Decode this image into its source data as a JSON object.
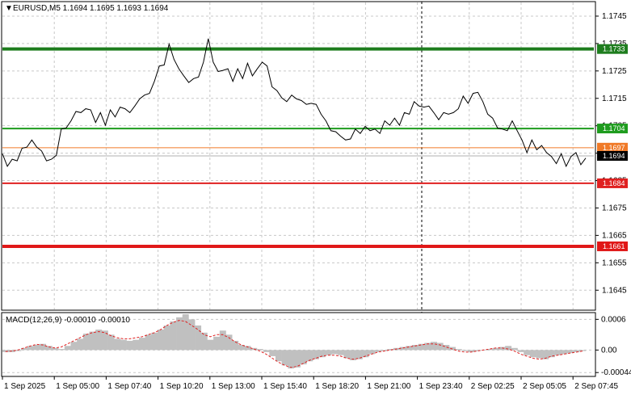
{
  "header": {
    "symbol_info": "EURUSD,M5  1.1694 1.1695 1.1693 1.1694"
  },
  "price_scale": {
    "ticks": [
      "1.1745",
      "1.1735",
      "1.1725",
      "1.1715",
      "1.1705",
      "1.1695",
      "1.1685",
      "1.1675",
      "1.1665",
      "1.1655",
      "1.1645"
    ]
  },
  "levels": [
    {
      "label": "1.1733",
      "color": "#1e7d1e"
    },
    {
      "label": "1.1704",
      "color": "#1e9c1e"
    },
    {
      "label": "1.1697",
      "color": "#f07a28"
    },
    {
      "label": "1.1694",
      "color": "#000000"
    },
    {
      "label": "1.1684",
      "color": "#e02020"
    },
    {
      "label": "1.1661",
      "color": "#e01818"
    }
  ],
  "macd": {
    "label": "MACD(12,26,9) -0.00010 -0.00010",
    "ticks": [
      "0.0006",
      "0.00",
      "-0.00044"
    ]
  },
  "time_axis": {
    "labels": [
      "1 Sep 2025",
      "1 Sep 05:00",
      "1 Sep 07:40",
      "1 Sep 10:20",
      "1 Sep 13:00",
      "1 Sep 15:40",
      "1 Sep 18:20",
      "1 Sep 21:00",
      "1 Sep 23:40",
      "2 Sep 02:25",
      "2 Sep 05:05",
      "2 Sep 07:45"
    ]
  },
  "chart_data": {
    "type": "line",
    "title": "EURUSD,M5",
    "price_range": [
      1.1638,
      1.175
    ],
    "macd_range": [
      -0.0005,
      0.0007
    ],
    "price_series": [
      1.1694,
      1.1691,
      1.1692,
      1.1693,
      1.1696,
      1.1698,
      1.1699,
      1.1698,
      1.1695,
      1.1693,
      1.1692,
      1.1695,
      1.1703,
      1.1705,
      1.1706,
      1.1711,
      1.1709,
      1.1712,
      1.171,
      1.1707,
      1.1709,
      1.1706,
      1.171,
      1.1709,
      1.1711,
      1.1712,
      1.1709,
      1.1713,
      1.1714,
      1.1717,
      1.1716,
      1.1722,
      1.1726,
      1.1728,
      1.1734,
      1.173,
      1.1725,
      1.1724,
      1.172,
      1.1723,
      1.1722,
      1.1729,
      1.1736,
      1.1729,
      1.1724,
      1.1726,
      1.1725,
      1.1722,
      1.1725,
      1.1723,
      1.1727,
      1.1724,
      1.1725,
      1.1729,
      1.1726,
      1.172,
      1.1717,
      1.1716,
      1.1713,
      1.1717,
      1.1714,
      1.1715,
      1.1712,
      1.1714,
      1.1712,
      1.171,
      1.1706,
      1.1704,
      1.1702,
      1.1702,
      1.1699,
      1.1701,
      1.1703,
      1.1703,
      1.1704,
      1.1704,
      1.1703,
      1.1703,
      1.1706,
      1.1706,
      1.1707,
      1.1706,
      1.1709,
      1.171,
      1.1713,
      1.1713,
      1.1711,
      1.1713,
      1.1709,
      1.1708,
      1.1709,
      1.171,
      1.1709,
      1.1712,
      1.1715,
      1.1714,
      1.1716,
      1.1718,
      1.1713,
      1.171,
      1.1707,
      1.1705,
      1.1703,
      1.1704,
      1.1706,
      1.1704,
      1.1699,
      1.1696,
      1.1699,
      1.1697,
      1.1697,
      1.1696,
      1.1693,
      1.1692,
      1.1694,
      1.1691,
      1.1693,
      1.1696,
      1.169,
      1.1694
    ],
    "macd_hist": [
      -4e-05,
      -4e-05,
      -2e-05,
      4e-05,
      8e-05,
      0.0001,
      0.00012,
      8e-05,
      4e-05,
      2e-05,
      8e-05,
      0.00016,
      0.00022,
      0.00032,
      0.00036,
      0.0004,
      0.00038,
      0.0003,
      0.00022,
      0.0002,
      0.00018,
      0.0002,
      0.00024,
      0.0003,
      0.00034,
      0.0004,
      0.00048,
      0.00056,
      0.00064,
      0.0007,
      0.0006,
      0.00048,
      0.00034,
      0.0002,
      0.00026,
      0.00038,
      0.0003,
      0.00018,
      0.0001,
      8e-05,
      4e-05,
      2e-05,
      -4e-05,
      -0.00012,
      -0.00022,
      -0.0003,
      -0.00036,
      -0.00034,
      -0.00028,
      -0.00022,
      -0.00018,
      -0.00014,
      -0.0001,
      -8e-05,
      -0.0001,
      -0.00016,
      -0.0002,
      -0.00018,
      -0.00014,
      -8e-05,
      -4e-05,
      -2e-05,
      2e-05,
      4e-05,
      6e-05,
      8e-05,
      0.0001,
      0.00012,
      0.00014,
      0.00016,
      0.00014,
      0.0001,
      6e-05,
      2e-05,
      -2e-05,
      -4e-05,
      -2e-05,
      0.0,
      2e-05,
      4e-05,
      6e-05,
      8e-05,
      4e-05,
      -4e-05,
      -0.0001,
      -0.00014,
      -0.00016,
      -0.00018,
      -0.00014,
      -0.0001,
      -8e-05,
      -6e-05,
      -4e-05,
      -2e-05
    ],
    "macd_signal": [
      -3e-05,
      -2e-05,
      0.0,
      4e-05,
      8e-05,
      0.00011,
      0.0001,
      6e-05,
      4e-05,
      6e-05,
      0.00012,
      0.00018,
      0.00024,
      0.0003,
      0.00034,
      0.00036,
      0.00034,
      0.00028,
      0.00024,
      0.00022,
      0.00022,
      0.00024,
      0.00026,
      0.0003,
      0.00034,
      0.0004,
      0.00048,
      0.00054,
      0.00058,
      0.00056,
      0.00048,
      0.0004,
      0.0003,
      0.00026,
      0.0003,
      0.0003,
      0.00024,
      0.00016,
      0.0001,
      6e-05,
      2e-05,
      -2e-05,
      -8e-05,
      -0.00016,
      -0.00024,
      -0.0003,
      -0.00034,
      -0.00032,
      -0.00026,
      -0.0002,
      -0.00016,
      -0.00012,
      -0.0001,
      -0.0001,
      -0.00012,
      -0.00016,
      -0.00018,
      -0.00016,
      -0.00012,
      -8e-05,
      -4e-05,
      -2e-05,
      0.0,
      2e-05,
      4e-05,
      6e-05,
      8e-05,
      0.0001,
      0.00012,
      0.00012,
      0.0001,
      6e-05,
      2e-05,
      -2e-05,
      -4e-05,
      -4e-05,
      -2e-05,
      0.0,
      2e-05,
      4e-05,
      4e-05,
      2e-05,
      -2e-05,
      -8e-05,
      -0.00012,
      -0.00016,
      -0.00018,
      -0.00016,
      -0.00012,
      -0.0001,
      -8e-05,
      -6e-05,
      -4e-05,
      -2e-05
    ]
  }
}
